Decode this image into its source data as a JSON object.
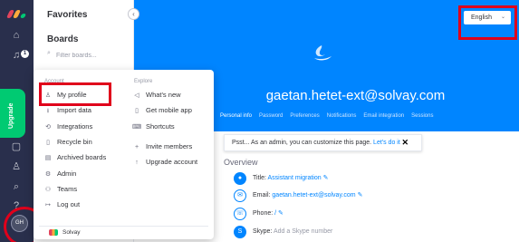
{
  "rail": {
    "upgrade_label": "Upgrade",
    "notification_count": "1",
    "avatar_initials": "GH",
    "icons": [
      "home-icon",
      "bell-icon",
      "inbox-icon",
      "person-add-icon",
      "search-icon",
      "help-icon"
    ]
  },
  "favorites": {
    "title": "Favorites",
    "boards_title": "Boards",
    "filter_placeholder": "Filter boards..."
  },
  "menu": {
    "account_header": "Account",
    "explore_header": "Explore",
    "account_items": [
      {
        "label": "My profile",
        "icon": "person-icon"
      },
      {
        "label": "Import data",
        "icon": "import-icon"
      },
      {
        "label": "Integrations",
        "icon": "integrations-icon"
      },
      {
        "label": "Recycle bin",
        "icon": "trash-icon"
      },
      {
        "label": "Archived boards",
        "icon": "archive-icon"
      },
      {
        "label": "Admin",
        "icon": "gear-icon"
      },
      {
        "label": "Teams",
        "icon": "teams-icon"
      },
      {
        "label": "Log out",
        "icon": "logout-icon"
      }
    ],
    "explore_items": [
      {
        "label": "What's new",
        "icon": "megaphone-icon"
      },
      {
        "label": "Get mobile app",
        "icon": "mobile-icon"
      },
      {
        "label": "Shortcuts",
        "icon": "keyboard-icon"
      },
      {
        "label": "Invite members",
        "icon": "plus-icon"
      },
      {
        "label": "Upgrade account",
        "icon": "arrow-up-icon"
      }
    ],
    "account_name": "Solvay"
  },
  "profile": {
    "email_title": "gaetan.hetet-ext@solvay.com",
    "tabs": [
      "Personal info",
      "Password",
      "Preferences",
      "Notifications",
      "Email integration",
      "Sessions"
    ],
    "active_tab": "Personal info",
    "language": "English",
    "tip_text": "Psst... As an admin, you can customize this page.",
    "tip_link": "Let's do it",
    "overview_title": "Overview",
    "fields": [
      {
        "label": "Title:",
        "value": "Assistant migration",
        "icon": "person-icon"
      },
      {
        "label": "Email:",
        "value": "gaetan.hetet-ext@solvay.com",
        "icon": "email-icon"
      },
      {
        "label": "Phone:",
        "value": "/",
        "icon": "phone-icon"
      },
      {
        "label": "Skype:",
        "value": "Add a Skype number",
        "icon": "skype-icon"
      }
    ]
  },
  "colors": {
    "rail": "#292f4c",
    "brand_blue": "#0085ff",
    "upgrade_green": "#00ca72",
    "highlight_red": "#e0001b"
  }
}
